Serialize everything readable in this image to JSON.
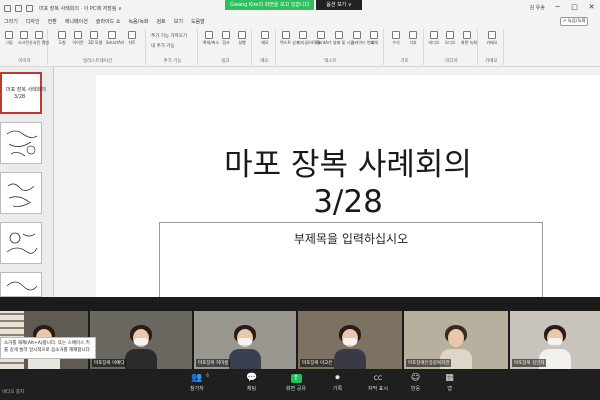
{
  "titlebar": {
    "doc_title": "마포 장복  사례회의 · 이 PC에 저장됨 ∨",
    "user": "김 유송",
    "min": "─",
    "max": "□",
    "close": "✕"
  },
  "share_banner": {
    "message": "Gwang Kim의 화면을 보고 있습니다",
    "button": "옵션 보기 ∨"
  },
  "menu": {
    "items": [
      "그리기",
      "디자인",
      "전환",
      "애니메이션",
      "슬라이드 쇼",
      "녹음/녹화",
      "검토",
      "보기",
      "도움말"
    ],
    "share_button": "↗ 녹음/녹화"
  },
  "ribbon": {
    "groups": [
      {
        "label": "이미지",
        "buttons": [
          "그림",
          "스크린샷",
          "사진 앨범"
        ]
      },
      {
        "label": "일러스트레이션",
        "buttons": [
          "도형",
          "아이콘",
          "3D 모델",
          "SmartArt",
          "차트"
        ]
      },
      {
        "label": "추가 기능",
        "buttons": [
          "추가 기능 가져오기",
          "내 추가 기능"
        ]
      },
      {
        "label": "링크",
        "buttons": [
          "확대/축소",
          "링크",
          "실행"
        ]
      },
      {
        "label": "메모",
        "buttons": [
          "메모"
        ]
      },
      {
        "label": "텍스트",
        "buttons": [
          "텍스트 상자",
          "머리글/바닥글",
          "WordArt",
          "날짜 및 시간",
          "슬라이드 번호",
          "개체"
        ]
      },
      {
        "label": "기호",
        "buttons": [
          "수식",
          "기호"
        ]
      },
      {
        "label": "미디어",
        "buttons": [
          "비디오",
          "오디오",
          "화면 녹화"
        ]
      },
      {
        "label": "카메오",
        "buttons": [
          "카메오"
        ]
      }
    ]
  },
  "thumbnails": [
    {
      "num": "1",
      "line1": "마포 장복  사례회의",
      "line2": "3/28",
      "active": true
    },
    {
      "num": "2",
      "active": false
    },
    {
      "num": "3",
      "active": false
    },
    {
      "num": "4",
      "active": false
    },
    {
      "num": "5",
      "active": false
    }
  ],
  "slide": {
    "title_line1": "마포 장복  사례회의",
    "title_line2": "3/28",
    "subtitle_placeholder": "부제목을 입력하십시오"
  },
  "gallery": {
    "participants": [
      {
        "name": "",
        "mask": false,
        "bg": "#5f5a52",
        "shirt": "#e9e6e1"
      },
      {
        "name": "마포장복 이예다",
        "mask": true,
        "bg": "#6a6660",
        "shirt": "#2b2b2b"
      },
      {
        "name": "마포장복 허미름",
        "mask": true,
        "bg": "#9a9690",
        "shirt": "#3a3f52"
      },
      {
        "name": "마포장복 이고은",
        "mask": true,
        "bg": "#7d7262",
        "shirt": "#3a3a46"
      },
      {
        "name": "마포장애인종합복지관",
        "mask": false,
        "bg": "#b8b09e",
        "shirt": "#e0d6c8"
      },
      {
        "name": "마포장복 김민지",
        "mask": true,
        "bg": "#c9c4bb",
        "shirt": "#f2f0ec"
      }
    ],
    "tooltip": "소거를 해제(Alt+A)합니다. 또는 스페이스 키를 길게 눌러 일시적으로 음소거를 해제합니다."
  },
  "controls": {
    "video_label": "비디오 중지",
    "buttons": [
      {
        "label": "참가자",
        "icon": "participants-icon",
        "glyph": "👥",
        "count": "6"
      },
      {
        "label": "채팅",
        "icon": "chat-icon",
        "glyph": "💬"
      },
      {
        "label": "화면 공유",
        "icon": "share-screen-icon",
        "glyph": "↑"
      },
      {
        "label": "기록",
        "icon": "record-icon",
        "glyph": "⏺"
      },
      {
        "label": "자막 표시",
        "icon": "cc-icon",
        "glyph": "CC"
      },
      {
        "label": "반응",
        "icon": "reactions-icon",
        "glyph": "☺"
      },
      {
        "label": "앱",
        "icon": "apps-icon",
        "glyph": "▦"
      }
    ]
  }
}
